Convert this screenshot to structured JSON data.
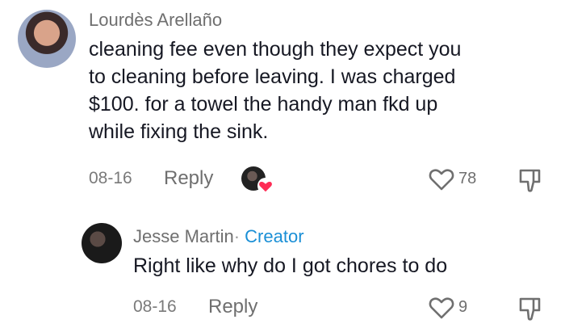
{
  "comment": {
    "username": "Lourdès Arellaño",
    "text_lines": [
      "cleaning fee even though they expect you",
      "to cleaning before leaving. I was charged",
      "$100. for a towel the handy man fkd up",
      "while fixing the sink."
    ],
    "date": "08-16",
    "reply_label": "Reply",
    "like_count": "78"
  },
  "reply": {
    "username": "Jesse Martin",
    "separator": "·",
    "creator_label": "Creator",
    "text": "Right like why do I got chores to do",
    "date": "08-16",
    "reply_label": "Reply",
    "like_count": "9"
  },
  "icons": {
    "like": "heart-outline-icon",
    "dislike": "thumbs-down-icon",
    "liked_by_creator": "creator-liked-badge"
  },
  "colors": {
    "creator_blue": "#1a8fd6",
    "badge_red": "#fe2c55"
  }
}
